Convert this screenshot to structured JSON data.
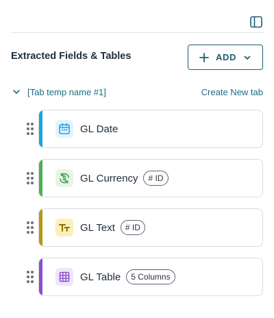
{
  "header": {
    "title": "Extracted Fields & Tables",
    "add_label": "ADD",
    "panel_icon": "panel-toggle-icon"
  },
  "tab": {
    "name": "[Tab temp name #1]",
    "create_label": "Create New tab"
  },
  "fields": [
    {
      "label": "GL Date",
      "badge": "",
      "icon": "calendar-icon",
      "accent": "#1aa3e6",
      "icon_bg": "#e3f3fb",
      "icon_color": "#1aa3e6"
    },
    {
      "label": "GL Currency",
      "badge": "# ID",
      "icon": "currency-icon",
      "accent": "#4caf50",
      "icon_bg": "#e6f5e6",
      "icon_color": "#3ea043"
    },
    {
      "label": "GL Text",
      "badge": "# ID",
      "icon": "text-icon",
      "accent": "#b8960c",
      "icon_bg": "#fbf0b8",
      "icon_color": "#8a6d00"
    },
    {
      "label": "GL Table",
      "badge": "5 Columns",
      "icon": "table-icon",
      "accent": "#8a4fd3",
      "icon_bg": "#efe6fa",
      "icon_color": "#8a4fd3"
    }
  ],
  "colors": {
    "primary": "#1b5e6b",
    "link": "#1b6b80"
  }
}
